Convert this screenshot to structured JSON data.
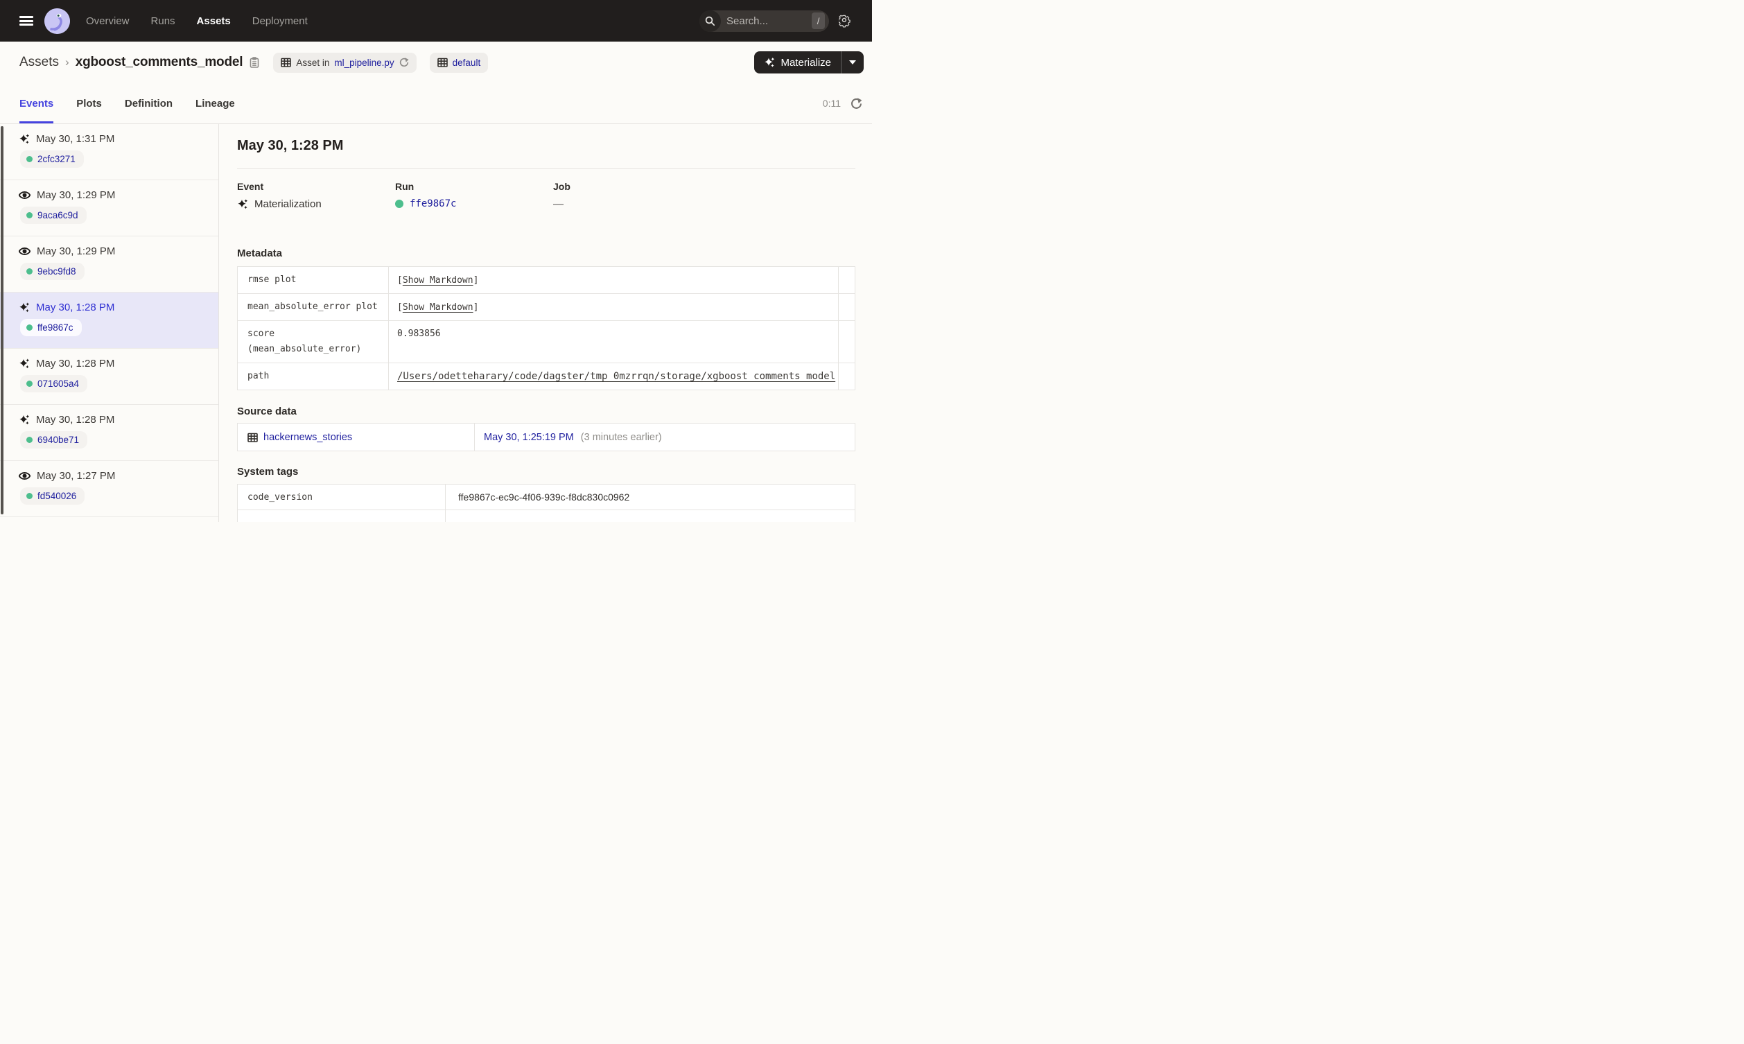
{
  "colors": {
    "nav_bg": "#211E1D",
    "accent": "#4543DF",
    "link_blue": "#21219F",
    "status_green": "#4DBE8D",
    "selected_row_bg": "#E8E7F8"
  },
  "topnav": {
    "nav_items": [
      {
        "label": "Overview",
        "active": false
      },
      {
        "label": "Runs",
        "active": false
      },
      {
        "label": "Assets",
        "active": true
      },
      {
        "label": "Deployment",
        "active": false
      }
    ],
    "search": {
      "placeholder": "Search...",
      "shortcut": "/"
    }
  },
  "header": {
    "breadcrumb_root": "Assets",
    "breadcrumb_sep": "›",
    "asset_name": "xgboost_comments_model",
    "chip_asset_prefix": "Asset in",
    "chip_asset_file": "ml_pipeline.py",
    "chip_group": "default",
    "materialize_label": "Materialize"
  },
  "tabs": {
    "items": [
      {
        "label": "Events",
        "active": true
      },
      {
        "label": "Plots",
        "active": false
      },
      {
        "label": "Definition",
        "active": false
      },
      {
        "label": "Lineage",
        "active": false
      }
    ],
    "refresh_countdown": "0:11"
  },
  "sidebar": {
    "events": [
      {
        "icon": "materialization",
        "date": "May 30, 1:31 PM",
        "run_id": "2cfc3271",
        "selected": false
      },
      {
        "icon": "observation",
        "date": "May 30, 1:29 PM",
        "run_id": "9aca6c9d",
        "selected": false
      },
      {
        "icon": "observation",
        "date": "May 30, 1:29 PM",
        "run_id": "9ebc9fd8",
        "selected": false
      },
      {
        "icon": "materialization",
        "date": "May 30, 1:28 PM",
        "run_id": "ffe9867c",
        "selected": true
      },
      {
        "icon": "materialization",
        "date": "May 30, 1:28 PM",
        "run_id": "071605a4",
        "selected": false
      },
      {
        "icon": "materialization",
        "date": "May 30, 1:28 PM",
        "run_id": "6940be71",
        "selected": false
      },
      {
        "icon": "observation",
        "date": "May 30, 1:27 PM",
        "run_id": "fd540026",
        "selected": false
      }
    ]
  },
  "detail": {
    "title": "May 30, 1:28 PM",
    "event_label": "Event",
    "event_value": "Materialization",
    "run_label": "Run",
    "run_value": "ffe9867c",
    "job_label": "Job",
    "job_value": "—"
  },
  "metadata": {
    "heading": "Metadata",
    "bracket_open": "[",
    "bracket_close": "]",
    "show_markdown_label": "Show Markdown",
    "rows": [
      {
        "key": "rmse plot",
        "type": "markdown"
      },
      {
        "key": "mean_absolute_error plot",
        "type": "markdown"
      },
      {
        "key": "score\n(mean_absolute_error)",
        "type": "text",
        "value": "0.983856"
      },
      {
        "key": "path",
        "type": "path_link",
        "value": "/Users/odetteharary/code/dagster/tmp_0mzrrqn/storage/xgboost_comments_model"
      }
    ]
  },
  "source_data": {
    "heading": "Source data",
    "asset": "hackernews_stories",
    "timestamp": "May 30, 1:25:19 PM",
    "timestamp_note": "(3 minutes earlier)"
  },
  "system_tags": {
    "heading": "System tags",
    "rows": [
      {
        "key": "code_version",
        "value": "ffe9867c-ec9c-4f06-939c-f8dc830c0962"
      }
    ]
  }
}
